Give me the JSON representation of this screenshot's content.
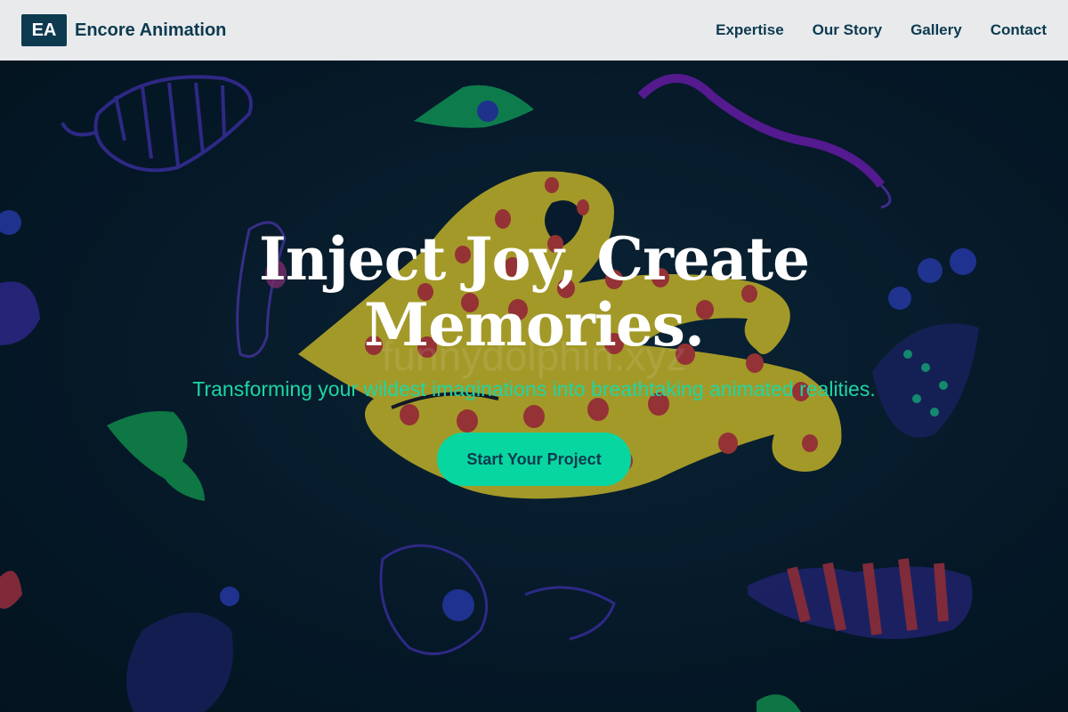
{
  "header": {
    "logo_text": "EA",
    "brand_name": "Encore Animation",
    "nav": [
      "Expertise",
      "Our Story",
      "Gallery",
      "Contact"
    ]
  },
  "hero": {
    "headline_line1": "Inject Joy, Create",
    "headline_line2": "Memories.",
    "subheadline": "Transforming your wildest imaginations into breathtaking animated realities.",
    "cta_label": "Start Your Project",
    "watermark": "funnydolphin.xyz"
  },
  "colors": {
    "header_bg": "#e8eaec",
    "brand": "#0d3a4f",
    "accent": "#08d6a0",
    "subheadline": "#1ed6a3",
    "hero_bg": "#061a2a"
  }
}
